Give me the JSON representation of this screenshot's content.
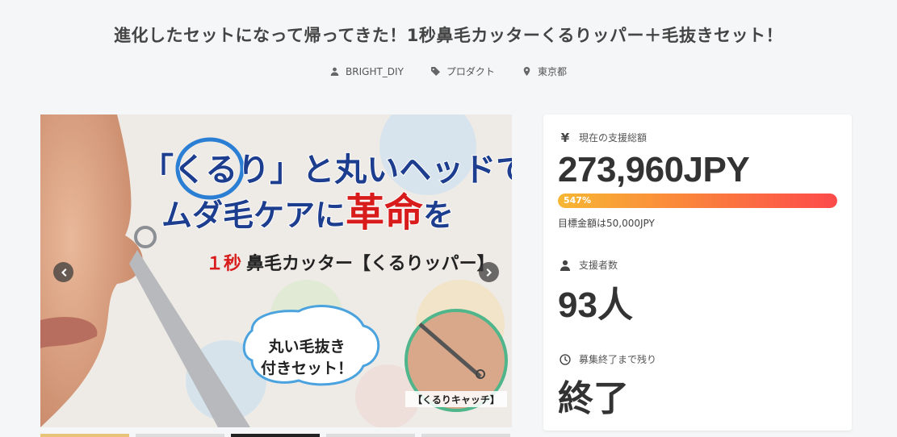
{
  "header": {
    "title": "進化したセットになって帰ってきた！1秒鼻毛カッターくるりッパー＋毛抜きセット！",
    "owner": "BRIGHT_DIY",
    "category": "プロダクト",
    "location": "東京都"
  },
  "hero": {
    "headline_quote_open": "「",
    "headline_kururi": "くるり",
    "headline_rest1": "」と丸いヘッドで",
    "headline_line2a": "ムダ毛ケアに",
    "headline_line2b": "革命",
    "headline_line2c": "を",
    "product_num": "１秒",
    "product_name": "鼻毛カッター【くるりッパー】",
    "bubble_line1": "丸い毛抜き",
    "bubble_line2": "付きセット！",
    "circle_caption": "【くるりキャッチ】"
  },
  "stats": {
    "amount_label": "現在の支援総額",
    "amount_value": "273,960JPY",
    "progress_percent_label": "547%",
    "progress_fraction": 1.0,
    "goal_text": "目標金額は50,000JPY",
    "backers_label": "支援者数",
    "backers_value": "93人",
    "remaining_label": "募集終了まで残り",
    "remaining_value": "終了",
    "yen_glyph": "¥"
  },
  "colors": {
    "progress_start": "#f7b733",
    "progress_end": "#fc4a4a",
    "headline_blue": "#1d3d8f",
    "headline_red": "#d81b1b"
  }
}
